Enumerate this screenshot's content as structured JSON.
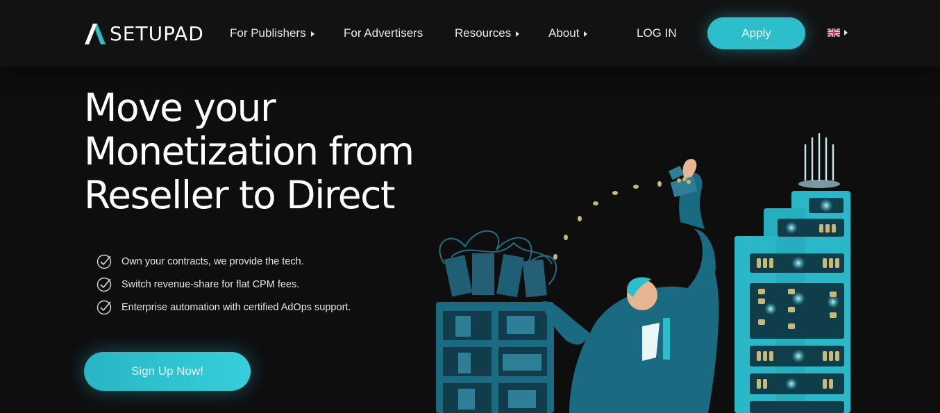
{
  "brand": {
    "name": "SETUPAD",
    "accent": "#2dbecb",
    "background": "#0e0e0f"
  },
  "nav": {
    "items": [
      {
        "label": "For Publishers",
        "has_submenu": true
      },
      {
        "label": "For Advertisers",
        "has_submenu": false
      },
      {
        "label": "Resources",
        "has_submenu": true
      },
      {
        "label": "About",
        "has_submenu": true
      }
    ],
    "login_label": "LOG IN",
    "apply_label": "Apply",
    "language_icon": "uk-flag-icon"
  },
  "hero": {
    "title_lines": [
      "Move your",
      "Monetization from",
      "Reseller to Direct"
    ],
    "features": [
      "Own your contracts, we provide the tech.",
      "Switch revenue-share for flat CPM fees.",
      "Enterprise automation with certified AdOps support."
    ],
    "cta_label": "Sign Up Now!"
  }
}
